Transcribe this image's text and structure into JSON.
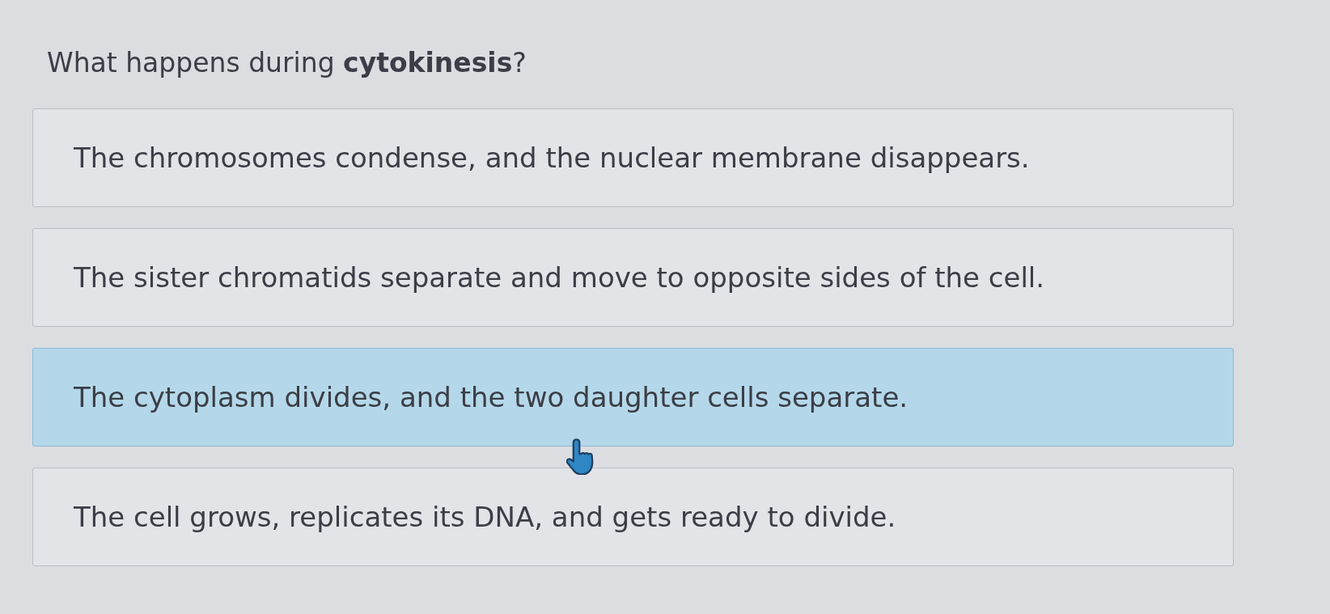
{
  "question": "What happens during **cytokinesis**?",
  "options": [
    {
      "text": "The chromosomes condense, and the nuclear membrane disappears.",
      "selected": false
    },
    {
      "text": "The sister chromatids separate and move to opposite sides of the cell.",
      "selected": false
    },
    {
      "text": "The cytoplasm divides, and the two daughter cells separate.",
      "selected": true
    },
    {
      "text": "The cell grows, replicates its DNA, and gets ready to divide.",
      "selected": false
    }
  ]
}
